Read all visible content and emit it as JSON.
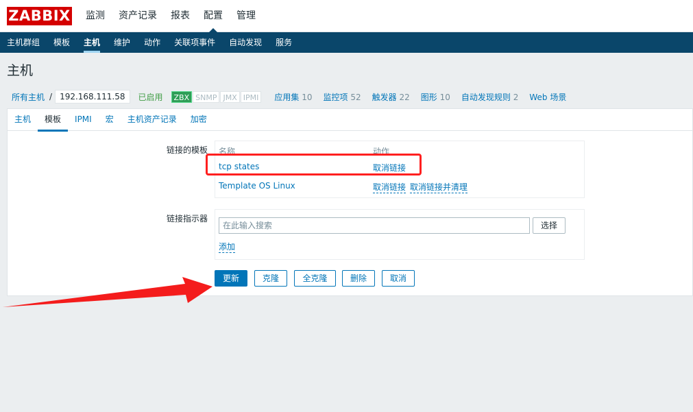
{
  "logo": "ZABBIX",
  "top_nav": [
    "监测",
    "资产记录",
    "报表",
    "配置",
    "管理"
  ],
  "sub_nav": [
    "主机群组",
    "模板",
    "主机",
    "维护",
    "动作",
    "关联项事件",
    "自动发现",
    "服务"
  ],
  "page_title": "主机",
  "host_nav": {
    "all_hosts": "所有主机",
    "separator": "/",
    "host": "192.168.111.58",
    "status": "已启用",
    "badges": [
      "ZBX",
      "SNMP",
      "JMX",
      "IPMI"
    ],
    "links": [
      {
        "label": "应用集",
        "count": "10"
      },
      {
        "label": "监控项",
        "count": "52"
      },
      {
        "label": "触发器",
        "count": "22"
      },
      {
        "label": "图形",
        "count": "10"
      },
      {
        "label": "自动发现规则",
        "count": "2"
      },
      {
        "label": "Web 场景",
        "count": ""
      }
    ]
  },
  "tabs": [
    "主机",
    "模板",
    "IPMI",
    "宏",
    "主机资产记录",
    "加密"
  ],
  "linked_templates": {
    "label": "链接的模板",
    "col_name": "名称",
    "col_action": "动作",
    "rows": [
      {
        "name": "tcp states",
        "actions": [
          "取消链接"
        ]
      },
      {
        "name": "Template OS Linux",
        "actions": [
          "取消链接",
          "取消链接并清理"
        ]
      }
    ]
  },
  "link_indicator": {
    "label": "链接指示器",
    "placeholder": "在此输入搜索",
    "select_button": "选择",
    "add_link": "添加"
  },
  "buttons": {
    "update": "更新",
    "clone": "克隆",
    "full_clone": "全克隆",
    "delete": "删除",
    "cancel": "取消"
  }
}
